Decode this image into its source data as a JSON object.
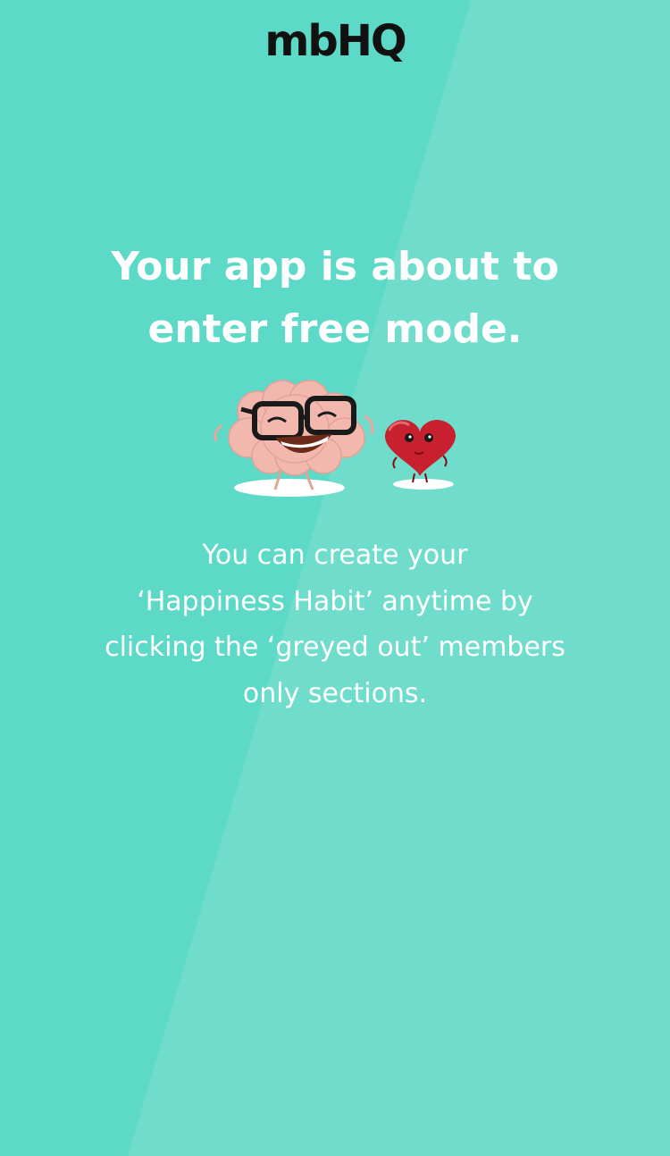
{
  "brand": {
    "logo_text": "mbHQ"
  },
  "main": {
    "headline_line1": "Your app is about to",
    "headline_line2": "enter free mode.",
    "body_line1": "You can create your",
    "body_line2": "‘Happiness Habit’ anytime by",
    "body_line3": "clicking the ‘greyed out’ members",
    "body_line4": "only sections."
  },
  "illustration": {
    "icons": [
      "brain-character-icon",
      "heart-character-icon"
    ]
  },
  "colors": {
    "background": "#5dd9c7",
    "background_light": "#6fdcca",
    "text": "#ffffff",
    "logo": "#111111",
    "brain": "#f2b8ad",
    "heart": "#c8202e"
  }
}
